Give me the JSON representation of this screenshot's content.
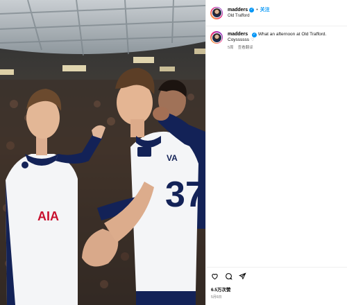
{
  "post": {
    "username": "madders",
    "follow_label": "关注",
    "separator": "•",
    "location": "Old Trafford",
    "caption": {
      "username": "madders",
      "text": "What an afternoon at Old Trafford. Coyssssss",
      "age": "5周",
      "translate_label": "查看翻译"
    },
    "likes": "6.5万次赞",
    "timestamp": "5月6日"
  },
  "photo": {
    "player_left_sponsor": "AIA",
    "player_right_number": "37",
    "player_right_name": "VA"
  },
  "colors": {
    "accent": "#0095f6",
    "kit_navy": "#132257",
    "kit_white": "#f4f5f7"
  },
  "icons": [
    "heart-icon",
    "comment-icon",
    "share-icon",
    "verified-icon"
  ]
}
